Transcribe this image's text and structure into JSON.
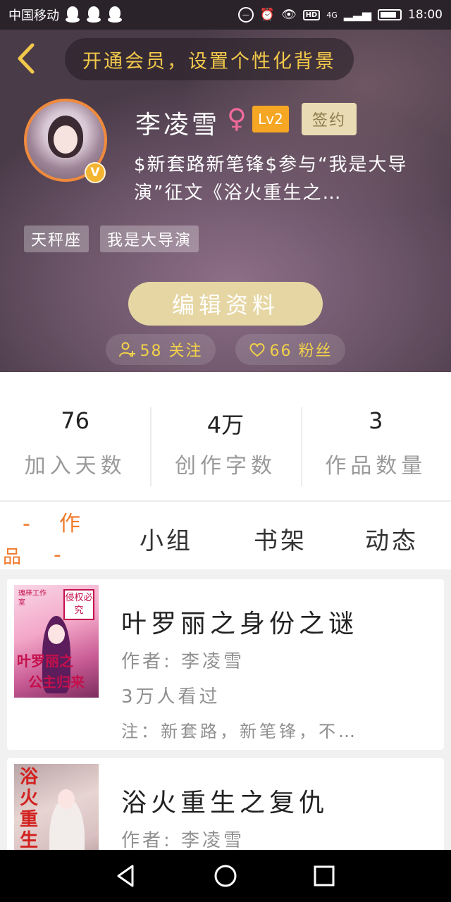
{
  "status_bar": {
    "carrier": "中国移动",
    "network": "4G",
    "time": "18:00",
    "icons": [
      "qq-icon",
      "qq-icon",
      "qq-icon",
      "dnd-icon",
      "alarm-icon",
      "eye-icon",
      "hd-icon",
      "signal-icon",
      "battery-icon"
    ]
  },
  "header": {
    "vip_banner": "开通会员，设置个性化背景",
    "username": "李凌雪",
    "gender_symbol": "♀",
    "level": "Lv2",
    "signed_badge": "签约",
    "verified_mark": "V",
    "bio": "$新套路新笔锋$参与“我是大导演”征文《浴火重生之…",
    "tags": [
      "天秤座",
      "我是大导演"
    ],
    "edit_button": "编辑资料",
    "following": "58 关注",
    "fans": "66 粉丝"
  },
  "stats": [
    {
      "value": "76",
      "label": "加入天数"
    },
    {
      "value": "4万",
      "label": "创作字数"
    },
    {
      "value": "3",
      "label": "作品数量"
    }
  ],
  "tabs": {
    "works_dash1": "-",
    "works_char1": "作",
    "works_char2": "品",
    "works_dash2": "-",
    "group": "小组",
    "shelf": "书架",
    "moments": "动态"
  },
  "books": [
    {
      "title": "叶罗丽之身份之谜",
      "author": "作者: 李凌雪",
      "reads": "3万人看过",
      "note": "注：新套路，新笔锋，不…",
      "cover_text_top": "叶罗丽之",
      "cover_text_bottom": "公主归来",
      "cover_seal": "侵权必究",
      "cover_studio": "瑰梓工作室"
    },
    {
      "title": "浴火重生之复仇",
      "author": "作者: 李凌雪",
      "cover_text_top": "浴火重生"
    }
  ],
  "colors": {
    "accent_orange": "#f07a2a",
    "vip_yellow": "#f2c84b",
    "level_badge": "#f5a623",
    "edit_button": "#e6d6a3",
    "gender_pink": "#f06b9a"
  }
}
